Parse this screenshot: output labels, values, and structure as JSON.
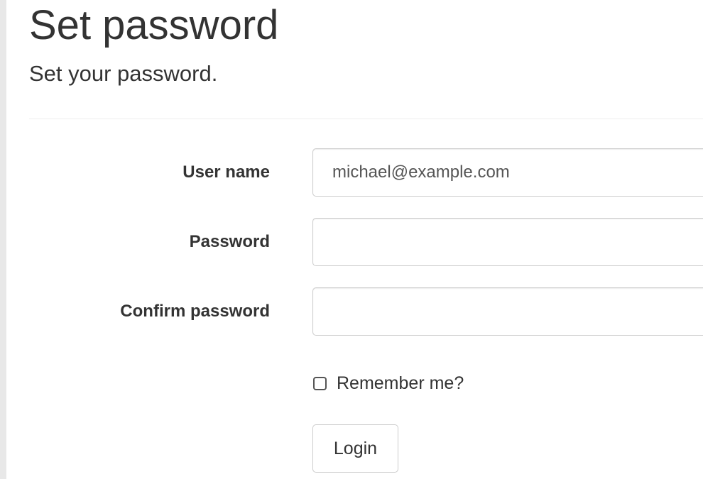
{
  "header": {
    "title": "Set password",
    "subtitle": "Set your password."
  },
  "form": {
    "user_name": {
      "label": "User name",
      "value": "michael@example.com",
      "placeholder": ""
    },
    "password": {
      "label": "Password",
      "value": "",
      "placeholder": ""
    },
    "confirm_password": {
      "label": "Confirm password",
      "value": "",
      "placeholder": ""
    },
    "remember_me": {
      "label": "Remember me?",
      "checked": false
    },
    "login_label": "Login"
  },
  "colors": {
    "text": "#333333",
    "input_text": "#555555",
    "border": "#cccccc",
    "divider": "#eeeeee",
    "left_rule": "#e8e8e8"
  },
  "icons": {
    "remember_checkbox": "checkbox-unchecked-icon"
  }
}
